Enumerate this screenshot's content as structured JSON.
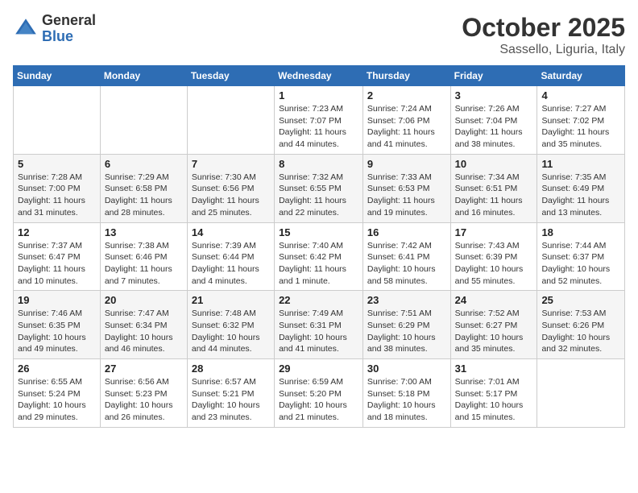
{
  "header": {
    "logo_general": "General",
    "logo_blue": "Blue",
    "month": "October 2025",
    "location": "Sassello, Liguria, Italy"
  },
  "days_of_week": [
    "Sunday",
    "Monday",
    "Tuesday",
    "Wednesday",
    "Thursday",
    "Friday",
    "Saturday"
  ],
  "weeks": [
    [
      {
        "day": "",
        "info": ""
      },
      {
        "day": "",
        "info": ""
      },
      {
        "day": "",
        "info": ""
      },
      {
        "day": "1",
        "info": "Sunrise: 7:23 AM\nSunset: 7:07 PM\nDaylight: 11 hours and 44 minutes."
      },
      {
        "day": "2",
        "info": "Sunrise: 7:24 AM\nSunset: 7:06 PM\nDaylight: 11 hours and 41 minutes."
      },
      {
        "day": "3",
        "info": "Sunrise: 7:26 AM\nSunset: 7:04 PM\nDaylight: 11 hours and 38 minutes."
      },
      {
        "day": "4",
        "info": "Sunrise: 7:27 AM\nSunset: 7:02 PM\nDaylight: 11 hours and 35 minutes."
      }
    ],
    [
      {
        "day": "5",
        "info": "Sunrise: 7:28 AM\nSunset: 7:00 PM\nDaylight: 11 hours and 31 minutes."
      },
      {
        "day": "6",
        "info": "Sunrise: 7:29 AM\nSunset: 6:58 PM\nDaylight: 11 hours and 28 minutes."
      },
      {
        "day": "7",
        "info": "Sunrise: 7:30 AM\nSunset: 6:56 PM\nDaylight: 11 hours and 25 minutes."
      },
      {
        "day": "8",
        "info": "Sunrise: 7:32 AM\nSunset: 6:55 PM\nDaylight: 11 hours and 22 minutes."
      },
      {
        "day": "9",
        "info": "Sunrise: 7:33 AM\nSunset: 6:53 PM\nDaylight: 11 hours and 19 minutes."
      },
      {
        "day": "10",
        "info": "Sunrise: 7:34 AM\nSunset: 6:51 PM\nDaylight: 11 hours and 16 minutes."
      },
      {
        "day": "11",
        "info": "Sunrise: 7:35 AM\nSunset: 6:49 PM\nDaylight: 11 hours and 13 minutes."
      }
    ],
    [
      {
        "day": "12",
        "info": "Sunrise: 7:37 AM\nSunset: 6:47 PM\nDaylight: 11 hours and 10 minutes."
      },
      {
        "day": "13",
        "info": "Sunrise: 7:38 AM\nSunset: 6:46 PM\nDaylight: 11 hours and 7 minutes."
      },
      {
        "day": "14",
        "info": "Sunrise: 7:39 AM\nSunset: 6:44 PM\nDaylight: 11 hours and 4 minutes."
      },
      {
        "day": "15",
        "info": "Sunrise: 7:40 AM\nSunset: 6:42 PM\nDaylight: 11 hours and 1 minute."
      },
      {
        "day": "16",
        "info": "Sunrise: 7:42 AM\nSunset: 6:41 PM\nDaylight: 10 hours and 58 minutes."
      },
      {
        "day": "17",
        "info": "Sunrise: 7:43 AM\nSunset: 6:39 PM\nDaylight: 10 hours and 55 minutes."
      },
      {
        "day": "18",
        "info": "Sunrise: 7:44 AM\nSunset: 6:37 PM\nDaylight: 10 hours and 52 minutes."
      }
    ],
    [
      {
        "day": "19",
        "info": "Sunrise: 7:46 AM\nSunset: 6:35 PM\nDaylight: 10 hours and 49 minutes."
      },
      {
        "day": "20",
        "info": "Sunrise: 7:47 AM\nSunset: 6:34 PM\nDaylight: 10 hours and 46 minutes."
      },
      {
        "day": "21",
        "info": "Sunrise: 7:48 AM\nSunset: 6:32 PM\nDaylight: 10 hours and 44 minutes."
      },
      {
        "day": "22",
        "info": "Sunrise: 7:49 AM\nSunset: 6:31 PM\nDaylight: 10 hours and 41 minutes."
      },
      {
        "day": "23",
        "info": "Sunrise: 7:51 AM\nSunset: 6:29 PM\nDaylight: 10 hours and 38 minutes."
      },
      {
        "day": "24",
        "info": "Sunrise: 7:52 AM\nSunset: 6:27 PM\nDaylight: 10 hours and 35 minutes."
      },
      {
        "day": "25",
        "info": "Sunrise: 7:53 AM\nSunset: 6:26 PM\nDaylight: 10 hours and 32 minutes."
      }
    ],
    [
      {
        "day": "26",
        "info": "Sunrise: 6:55 AM\nSunset: 5:24 PM\nDaylight: 10 hours and 29 minutes."
      },
      {
        "day": "27",
        "info": "Sunrise: 6:56 AM\nSunset: 5:23 PM\nDaylight: 10 hours and 26 minutes."
      },
      {
        "day": "28",
        "info": "Sunrise: 6:57 AM\nSunset: 5:21 PM\nDaylight: 10 hours and 23 minutes."
      },
      {
        "day": "29",
        "info": "Sunrise: 6:59 AM\nSunset: 5:20 PM\nDaylight: 10 hours and 21 minutes."
      },
      {
        "day": "30",
        "info": "Sunrise: 7:00 AM\nSunset: 5:18 PM\nDaylight: 10 hours and 18 minutes."
      },
      {
        "day": "31",
        "info": "Sunrise: 7:01 AM\nSunset: 5:17 PM\nDaylight: 10 hours and 15 minutes."
      },
      {
        "day": "",
        "info": ""
      }
    ]
  ]
}
